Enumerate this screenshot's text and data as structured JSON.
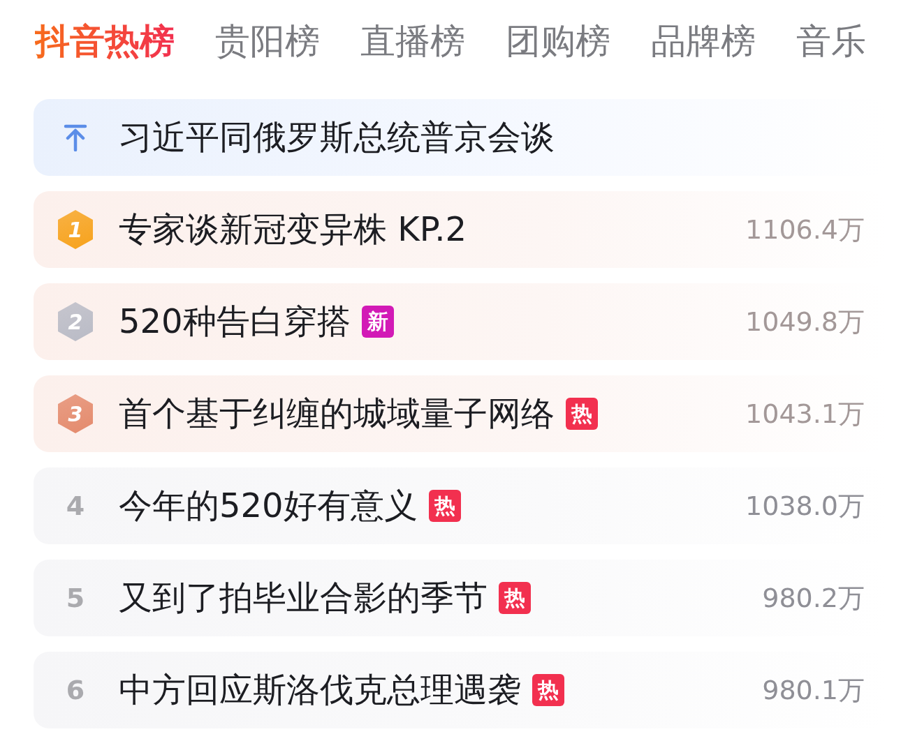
{
  "tabs": [
    {
      "label": "抖音热榜",
      "selected": true
    },
    {
      "label": "贵阳榜",
      "selected": false
    },
    {
      "label": "直播榜",
      "selected": false
    },
    {
      "label": "团购榜",
      "selected": false
    },
    {
      "label": "品牌榜",
      "selected": false
    },
    {
      "label": "音乐",
      "selected": false
    }
  ],
  "rows": [
    {
      "kind": "pinned",
      "title": "习近平同俄罗斯总统普京会谈"
    },
    {
      "kind": "medal",
      "rank": "1",
      "color": "#f7a21b",
      "title": "专家谈新冠变异株 KP.2",
      "heat": "1106.4万"
    },
    {
      "kind": "medal",
      "rank": "2",
      "color": "#b9bbc6",
      "title": "520种告白穿搭",
      "tag": {
        "label": "新",
        "color": "#d21ab6"
      },
      "heat": "1049.8万"
    },
    {
      "kind": "medal",
      "rank": "3",
      "color": "#e48a6c",
      "title": "首个基于纠缠的城域量子网络",
      "tag": {
        "label": "热",
        "color": "#f2304f"
      },
      "heat": "1043.1万"
    },
    {
      "kind": "plain",
      "rank": "4",
      "title": "今年的520好有意义",
      "tag": {
        "label": "热",
        "color": "#f2304f"
      },
      "heat": "1038.0万"
    },
    {
      "kind": "plain",
      "rank": "5",
      "title": "又到了拍毕业合影的季节",
      "tag": {
        "label": "热",
        "color": "#f2304f"
      },
      "heat": "980.2万"
    },
    {
      "kind": "plain",
      "rank": "6",
      "title": "中方回应斯洛伐克总理遇袭",
      "tag": {
        "label": "热",
        "color": "#f2304f"
      },
      "heat": "980.1万"
    }
  ]
}
